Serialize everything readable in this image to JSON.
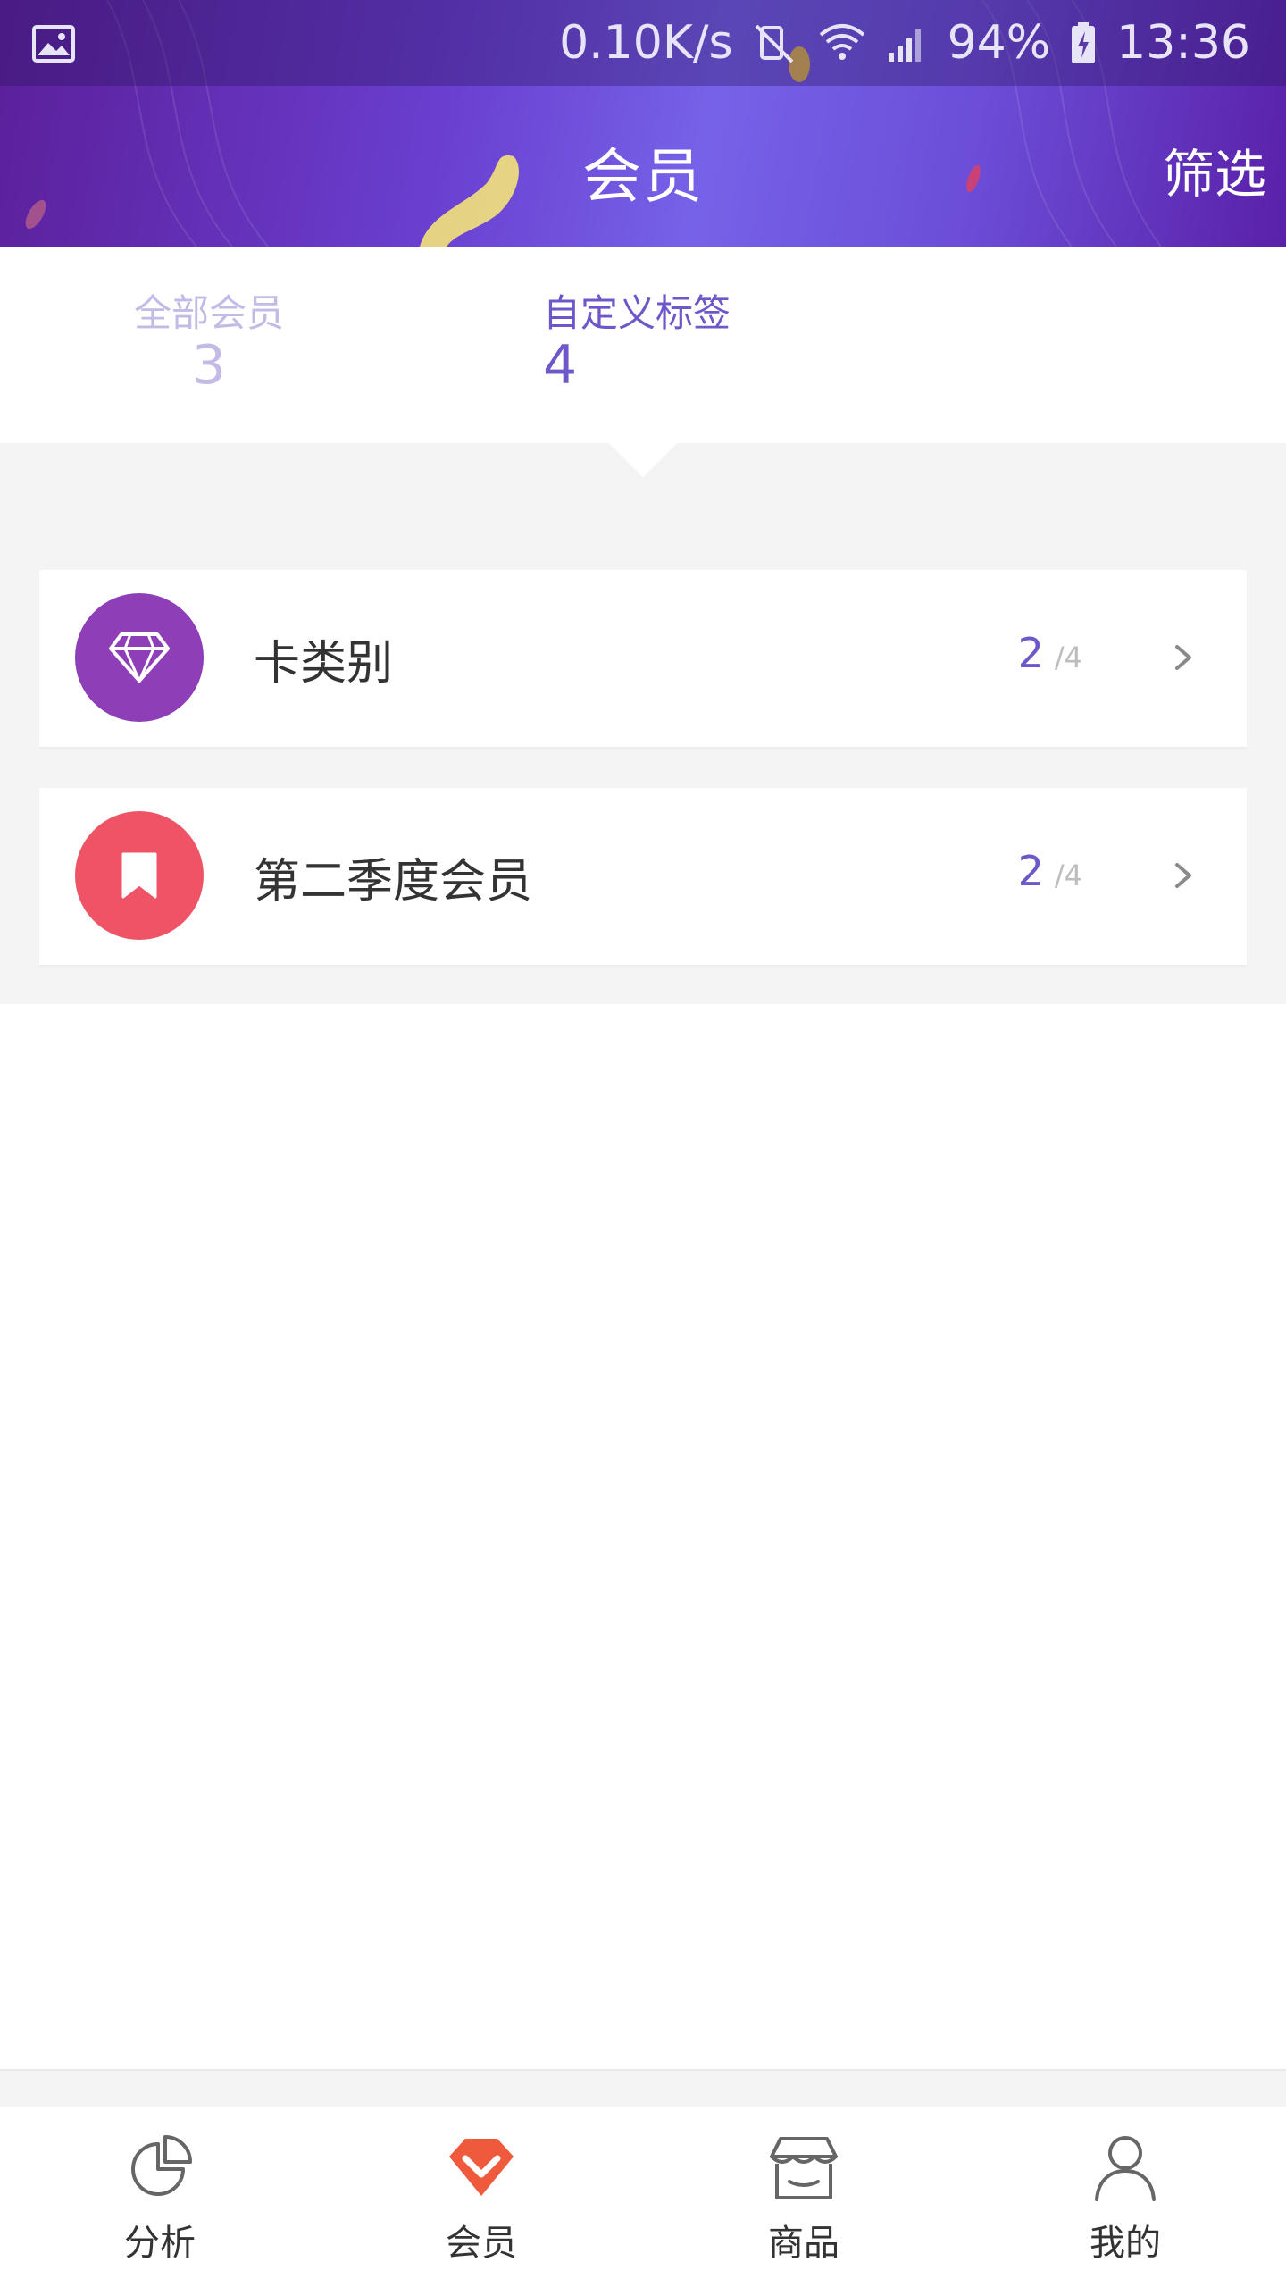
{
  "status_bar": {
    "network_speed": "0.10K/s",
    "battery": "94%",
    "time": "13:36"
  },
  "header": {
    "title": "会员",
    "filter_label": "筛选"
  },
  "tabs": [
    {
      "label": "全部会员",
      "count": "3",
      "active": false
    },
    {
      "label": "自定义标签",
      "count": "4",
      "active": true
    }
  ],
  "cards": [
    {
      "icon": "diamond-icon",
      "title": "卡类别",
      "count": "2",
      "total": "/4",
      "color": "#8e3fb8"
    },
    {
      "icon": "bookmark-icon",
      "title": "第二季度会员",
      "count": "2",
      "total": "/4",
      "color": "#ef5466"
    }
  ],
  "bottom_nav": [
    {
      "label": "分析",
      "icon": "pie-chart-icon",
      "active": false
    },
    {
      "label": "会员",
      "icon": "member-gem-icon",
      "active": true
    },
    {
      "label": "商品",
      "icon": "store-icon",
      "active": false
    },
    {
      "label": "我的",
      "icon": "person-icon",
      "active": false
    }
  ],
  "colors": {
    "accent": "#6d57c9",
    "active_nav": "#f05a3c",
    "inactive_tab": "#c3bbe6"
  }
}
